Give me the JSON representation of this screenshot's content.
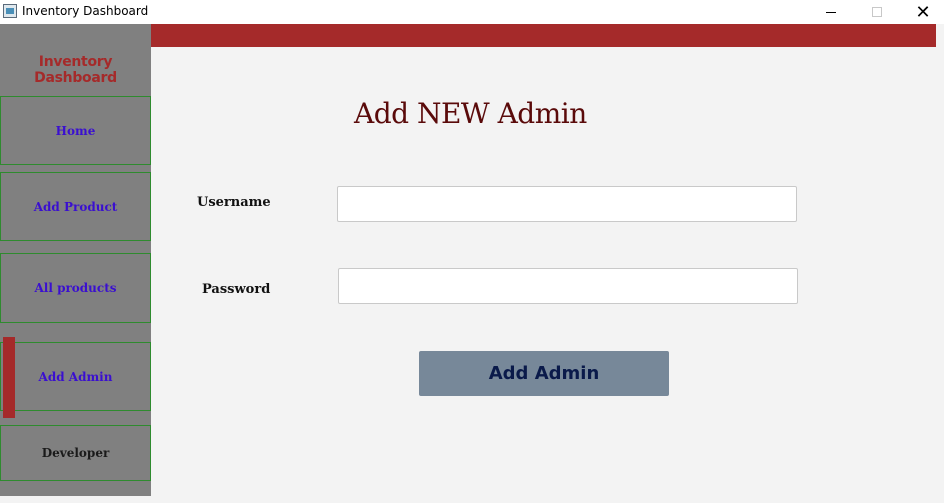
{
  "window": {
    "title": "Inventory Dashboard",
    "minimize_label": "",
    "maximize_label": "",
    "close_label": "✕"
  },
  "sidebar": {
    "brand": "Inventory Dashboard",
    "items": [
      {
        "label": "Home"
      },
      {
        "label": "Add Product"
      },
      {
        "label": "All products"
      },
      {
        "label": "Add Admin",
        "active": true
      },
      {
        "label": "Developer"
      }
    ]
  },
  "main": {
    "title": "Add NEW Admin",
    "username_label": "Username",
    "username_value": "",
    "password_label": "Password",
    "password_value": "",
    "submit_label": "Add Admin"
  },
  "colors": {
    "accent": "#a52a2a",
    "sidebar_bg": "#808080",
    "nav_text": "#3a0fd0",
    "button_bg": "#778899"
  }
}
